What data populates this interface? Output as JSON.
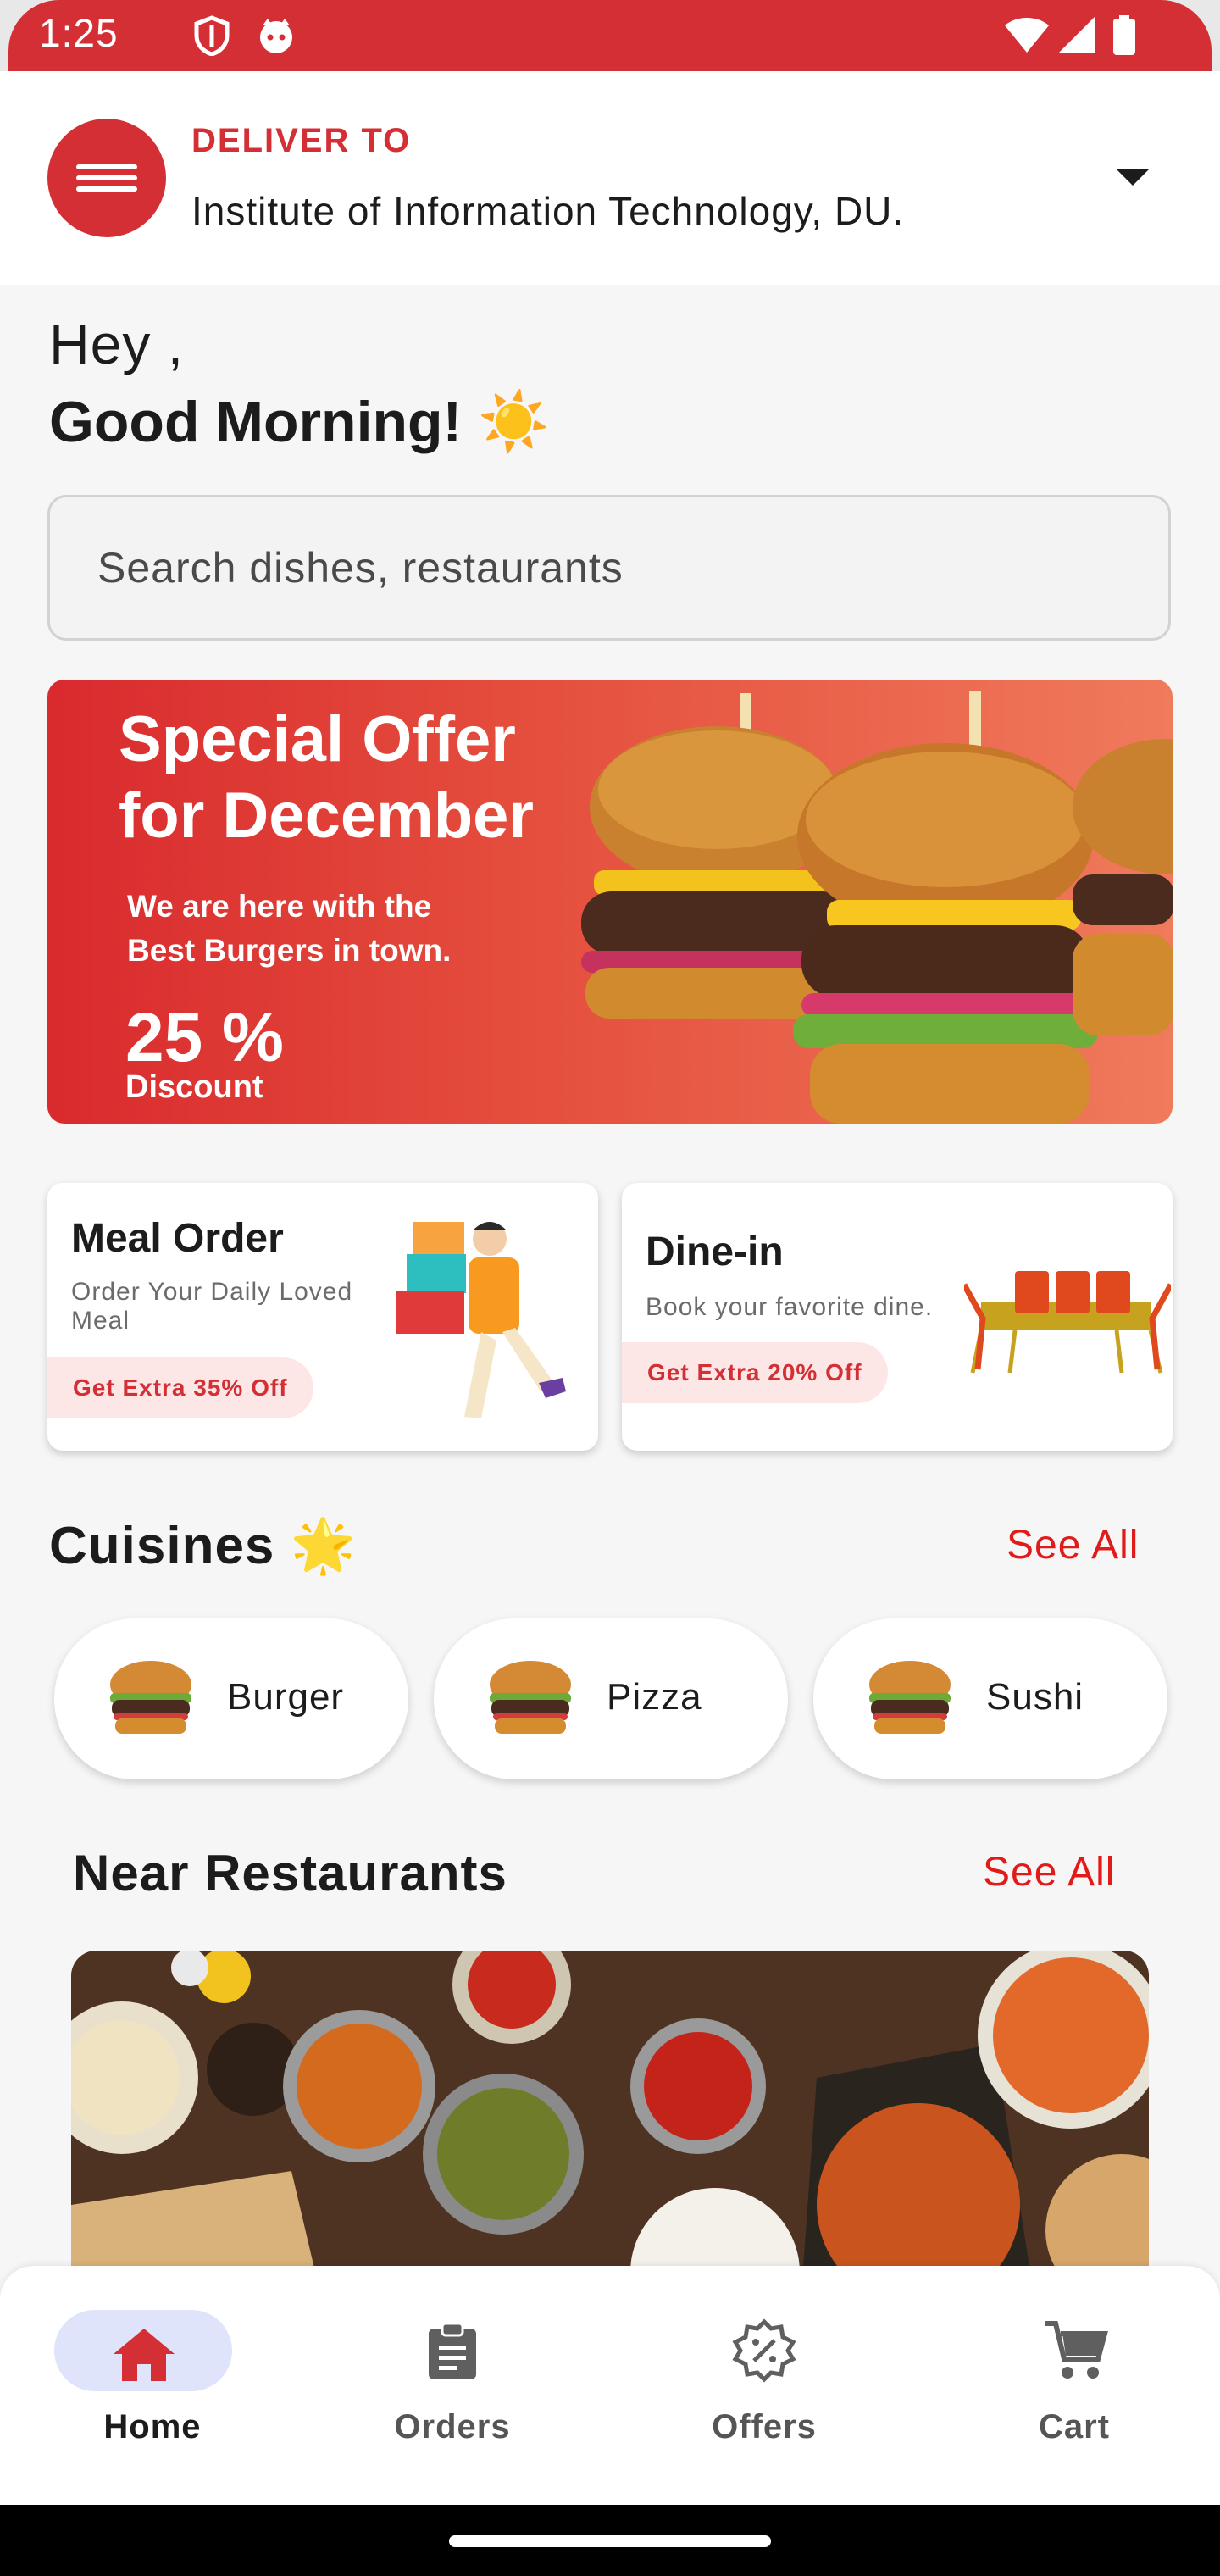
{
  "status_bar": {
    "time": "1:25"
  },
  "header": {
    "deliver_label": "DELIVER TO",
    "address": "Institute of Information Technology, DU."
  },
  "greeting": {
    "hey": "Hey ,",
    "message": "Good Morning! ☀️"
  },
  "search": {
    "placeholder": "Search dishes, restaurants"
  },
  "banner": {
    "title_line1": "Special Offer",
    "title_line2": "for December",
    "subtitle_line1": "We are here with the",
    "subtitle_line2": "Best Burgers in town.",
    "percent": "25 %",
    "discount_label": "Discount"
  },
  "services": [
    {
      "title": "Meal Order",
      "subtitle": "Order Your Daily Loved Meal",
      "badge": "Get Extra 35% Off"
    },
    {
      "title": "Dine-in",
      "subtitle": "Book your favorite dine.",
      "badge": "Get Extra 20% Off"
    }
  ],
  "cuisines": {
    "title": "Cuisines 🌟",
    "see_all": "See All",
    "items": [
      {
        "label": "Burger"
      },
      {
        "label": "Pizza"
      },
      {
        "label": "Sushi"
      }
    ]
  },
  "near_restaurants": {
    "title": "Near Restaurants",
    "see_all": "See All"
  },
  "bottom_nav": {
    "items": [
      {
        "label": "Home",
        "icon": "home-icon",
        "active": true
      },
      {
        "label": "Orders",
        "icon": "clipboard-icon",
        "active": false
      },
      {
        "label": "Offers",
        "icon": "discount-badge-icon",
        "active": false
      },
      {
        "label": "Cart",
        "icon": "cart-icon",
        "active": false
      }
    ]
  },
  "colors": {
    "brand_red": "#d32f35",
    "see_all_red": "#e11a1a",
    "badge_bg": "#fde6e6",
    "active_nav_pill": "#dfe4fb"
  }
}
